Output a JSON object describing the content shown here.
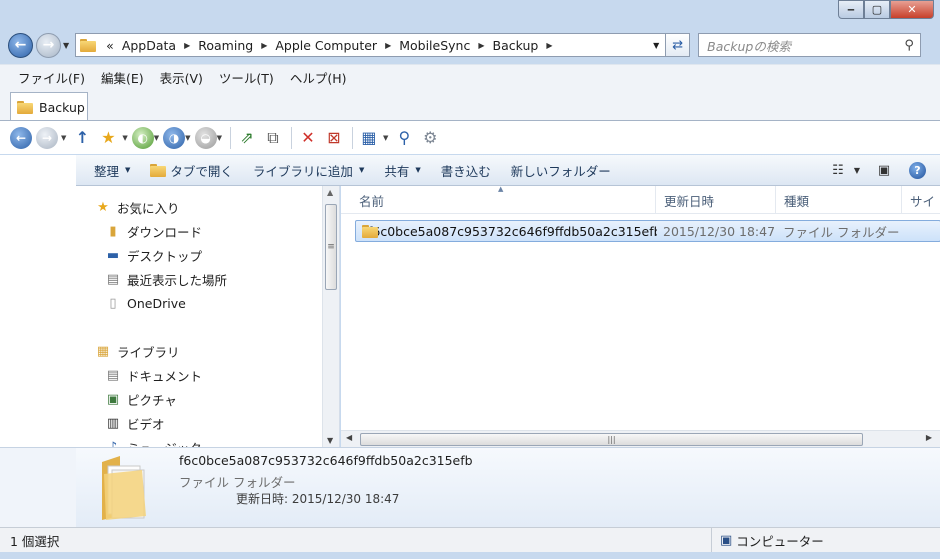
{
  "window": {
    "caption_min": "‒",
    "caption_max": "▢",
    "caption_close": "✕"
  },
  "address": {
    "overflow": "«",
    "crumbs": [
      "AppData",
      "Roaming",
      "Apple Computer",
      "MobileSync",
      "Backup"
    ],
    "search_placeholder": "Backupの検索"
  },
  "menu": [
    "ファイル(F)",
    "編集(E)",
    "表示(V)",
    "ツール(T)",
    "ヘルプ(H)"
  ],
  "tab": {
    "label": "Backup"
  },
  "commands": {
    "organize": "整理",
    "open_in_tab": "タブで開く",
    "add_to_library": "ライブラリに追加",
    "share": "共有",
    "burn": "書き込む",
    "new_folder": "新しいフォルダー"
  },
  "nav": {
    "favorites": "お気に入り",
    "downloads": "ダウンロード",
    "desktop": "デスクトップ",
    "recent": "最近表示した場所",
    "onedrive": "OneDrive",
    "libraries": "ライブラリ",
    "documents": "ドキュメント",
    "pictures": "ピクチャ",
    "videos": "ビデオ",
    "music": "ミュージック"
  },
  "columns": {
    "name": "名前",
    "date": "更新日時",
    "type": "種類",
    "size": "サイ"
  },
  "files": [
    {
      "name": "f6c0bce5a087c953732c646f9ffdb50a2c315efb",
      "date": "2015/12/30 18:47",
      "type": "ファイル フォルダー"
    }
  ],
  "details": {
    "name": "f6c0bce5a087c953732c646f9ffdb50a2c315efb",
    "type": "ファイル フォルダー",
    "date": "更新日時: 2015/12/30 18:47"
  },
  "status": {
    "selection": "1 個選択",
    "location": "コンピューター"
  },
  "colors": {
    "frame": "#c7d9ee",
    "selection_fill": "#cde2fa",
    "selection_border": "#84acdd",
    "accent_blue": "#2d61a8"
  },
  "icons": {
    "back": "back-arrow-icon",
    "forward": "forward-arrow-icon",
    "refresh": "refresh-icon",
    "search": "search-icon",
    "folder": "folder-icon"
  }
}
